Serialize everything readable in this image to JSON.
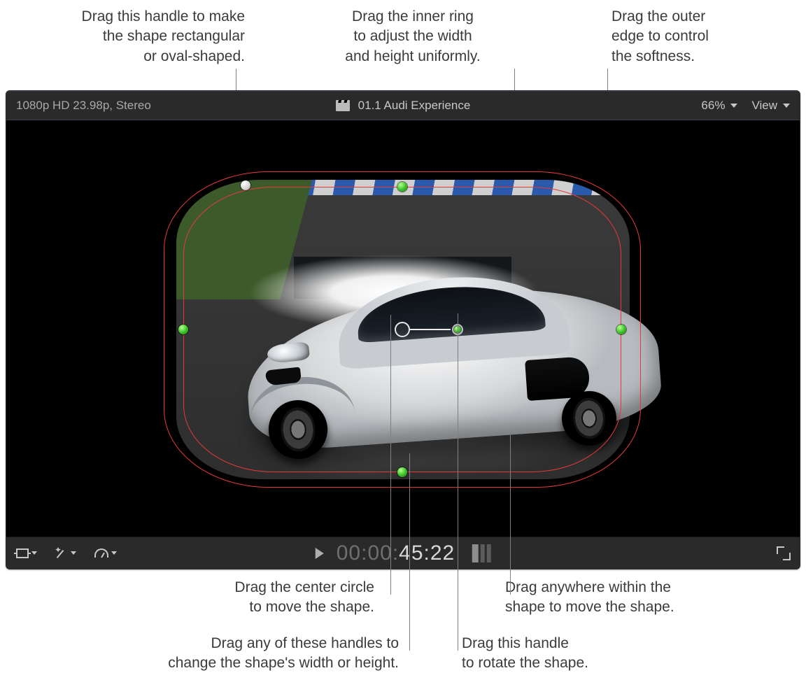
{
  "callouts": {
    "curvature": "Drag this handle to make\nthe shape rectangular\nor oval-shaped.",
    "inner_ring": "Drag the inner ring\nto adjust the width\nand height uniformly.",
    "outer_edge": "Drag the outer\nedge to control\nthe softness.",
    "center_circle": "Drag the center circle\nto move the shape.",
    "wh_handles": "Drag any of these handles to\nchange the shape's width or height.",
    "rotate_handle": "Drag this handle\nto rotate the shape.",
    "drag_inside": "Drag anywhere within the\nshape to move the shape."
  },
  "viewer": {
    "format": "1080p HD 23.98p, Stereo",
    "clip_title": "01.1 Audi Experience",
    "zoom": "66%",
    "view_label": "View",
    "timecode_dim": "00:00:",
    "timecode_bright": "45:22"
  }
}
